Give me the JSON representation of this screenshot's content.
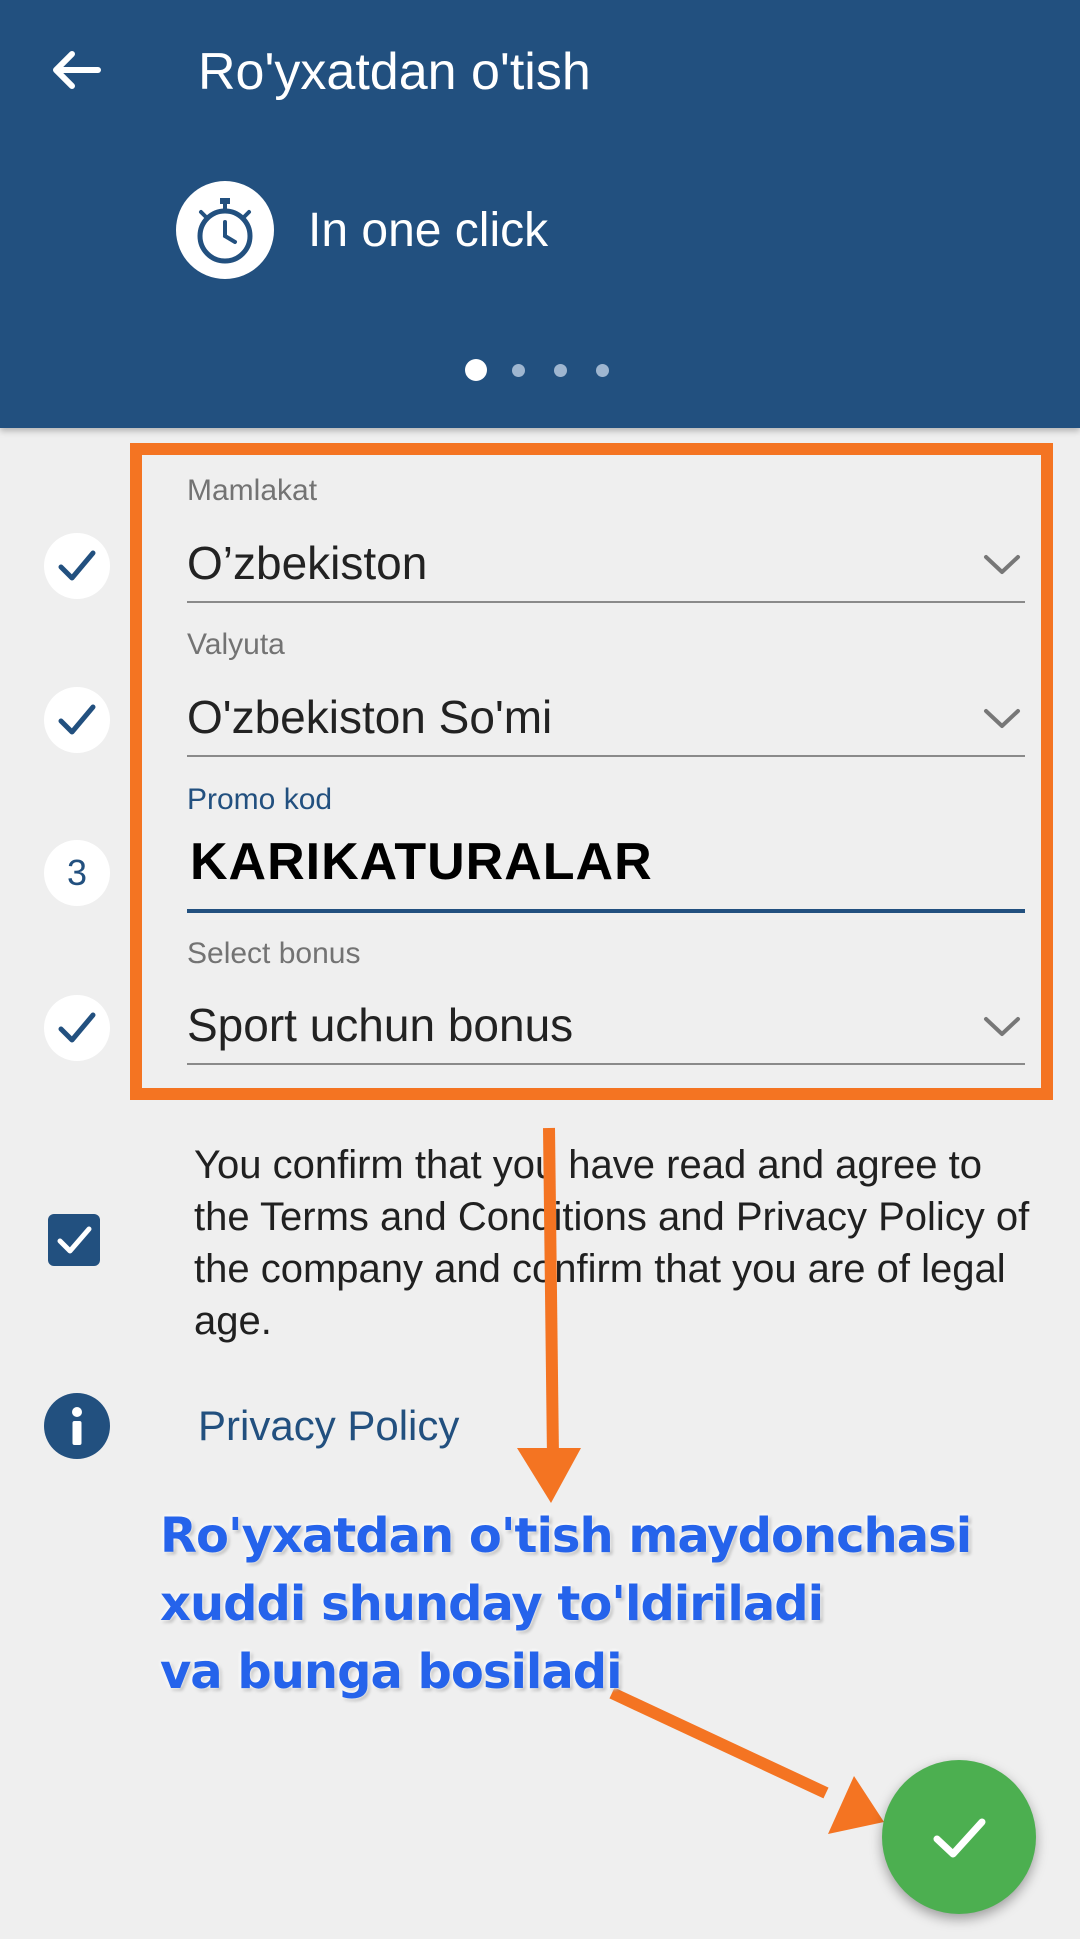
{
  "header": {
    "title": "Ro'yxatdan o'tish",
    "registration_mode": "In one click",
    "page_dots": 4,
    "active_dot": 0
  },
  "form": {
    "fields": [
      {
        "step_state": "done",
        "label": "Mamlakat",
        "value": "O’zbekiston",
        "type": "dropdown"
      },
      {
        "step_state": "done",
        "label": "Valyuta",
        "value": "O'zbekiston So'mi",
        "type": "dropdown"
      },
      {
        "step_state": "active",
        "step_number": "3",
        "label": "Promo kod",
        "value": "KARIKATURALAR",
        "type": "text"
      },
      {
        "step_state": "done",
        "label": "Select bonus",
        "value": "Sport uchun bonus",
        "type": "dropdown"
      }
    ],
    "terms_checked": true,
    "terms_text": "You confirm that you have read and agree to the Terms and Conditions and Privacy Policy of the company and confirm that you are of legal age.",
    "privacy_link": "Privacy Policy"
  },
  "annotation": {
    "lines": [
      "Ro'yxatdan o'tish maydonchasi",
      "xuddi shunday to'ldiriladi",
      "va bunga bosiladi"
    ],
    "highlight_color": "#f47422",
    "text_color": "#2563eb"
  },
  "colors": {
    "header_bg": "#22507f",
    "accent": "#22507f",
    "fab": "#4caf50",
    "background": "#efefef"
  }
}
